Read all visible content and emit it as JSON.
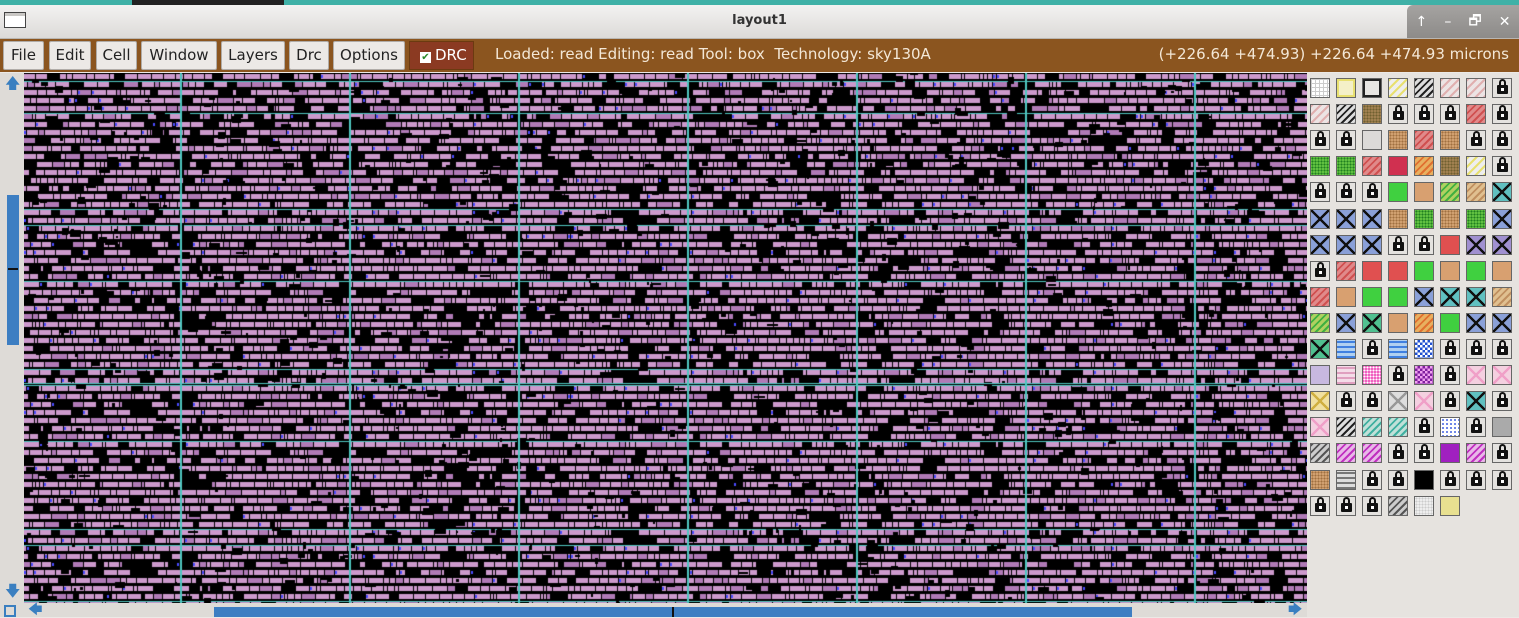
{
  "window": {
    "title": "layout1",
    "controls": [
      "↑",
      "–",
      "🗗",
      "✕"
    ]
  },
  "menubar": {
    "items": [
      {
        "label": "File",
        "name": "menu-file"
      },
      {
        "label": "Edit",
        "name": "menu-edit"
      },
      {
        "label": "Cell",
        "name": "menu-cell"
      },
      {
        "label": "Window",
        "name": "menu-window"
      },
      {
        "label": "Layers",
        "name": "menu-layers"
      },
      {
        "label": "Drc",
        "name": "menu-drc"
      },
      {
        "label": "Options",
        "name": "menu-options"
      }
    ],
    "drc_toggle": {
      "label": "DRC",
      "checked": true
    },
    "status_text": "Loaded: read Editing: read Tool: box  Technology: sky130A",
    "coords_text": "(+226.64 +474.93) +226.64 +474.93 microns"
  },
  "colors": {
    "menubar_bg": "#8b551f",
    "drc_bg": "#8b3a22",
    "title_strip": "#3fb1a7",
    "scroll_accent": "#3d7ec2",
    "canvas_bg": "#000000",
    "layout_pink": "#cc99cc",
    "layout_cyan": "#4fc6c0",
    "layout_blue": "#4a4aff"
  },
  "layout_view": {
    "description_layers": [
      "metal1",
      "locali",
      "via",
      "power-rails"
    ]
  },
  "palette": {
    "rows": [
      [
        "grid",
        "yellowbox",
        "box",
        "yellow-diag",
        "black-diag",
        "pink-diag",
        "pink-diag",
        "lock"
      ],
      [
        "pink-diag",
        "black-diag",
        "olive-dot",
        "lock",
        "lock",
        "lock",
        "red-diag",
        "lock"
      ],
      [
        "lock",
        "lock",
        "plain",
        "tan-dot",
        "red-diag",
        "tan-dot",
        "lock",
        "lock"
      ],
      [
        "green-dot",
        "green-dot",
        "red-diag",
        "crimson",
        "orange-diag",
        "olive-dot",
        "yellow-diag",
        "lock"
      ],
      [
        "lock",
        "lock",
        "lock",
        "green",
        "tan",
        "green-diag",
        "tan-diag",
        "cross-cyan"
      ],
      [
        "cross-blue",
        "cross-blue",
        "cross-blue",
        "tan-dot",
        "green-dot",
        "tan-dot",
        "green-dot",
        "cross-blue"
      ],
      [
        "cross-blue",
        "cross-blue",
        "cross-blue",
        "lock",
        "lock",
        "red",
        "cross-violet",
        "cross-violet"
      ],
      [
        "lock",
        "red-diag",
        "red",
        "red",
        "green",
        "tan",
        "green",
        "tan"
      ],
      [
        "red-diag",
        "tan",
        "green",
        "green",
        "cross-blue",
        "cross-cyan",
        "cross-cyan",
        "tan-diag"
      ],
      [
        "green-diag",
        "cross-blue",
        "cross-green",
        "tan",
        "orange-diag",
        "green",
        "cross-blue",
        "cross-blue"
      ],
      [
        "cross-green",
        "blue-wave",
        "lock",
        "blue-wave",
        "blue-check",
        "lock",
        "lock",
        "lock"
      ],
      [
        "lavender",
        "pink-wave",
        "magenta-dot",
        "lock",
        "purple-check",
        "lock",
        "pink-cross",
        "pink-cross"
      ],
      [
        "yellow-cross",
        "lock",
        "lock",
        "grey-cross",
        "pink-cross",
        "lock",
        "cross-cyan",
        "lock"
      ],
      [
        "pink-cross",
        "black-diag",
        "cyan-diag",
        "cyan-diag",
        "lock",
        "blue-dots",
        "lock",
        "grey"
      ],
      [
        "grey-diag",
        "magenta-diag",
        "magenta-diag",
        "lock",
        "lock",
        "purple",
        "magenta-diag",
        "lock"
      ],
      [
        "tan-dot",
        "grey-wave",
        "lock",
        "lock",
        "black",
        "lock",
        "lock",
        "lock"
      ],
      [
        "lock",
        "lock",
        "lock",
        "grey-diag",
        "light-dot",
        "yellow-solid"
      ]
    ]
  }
}
